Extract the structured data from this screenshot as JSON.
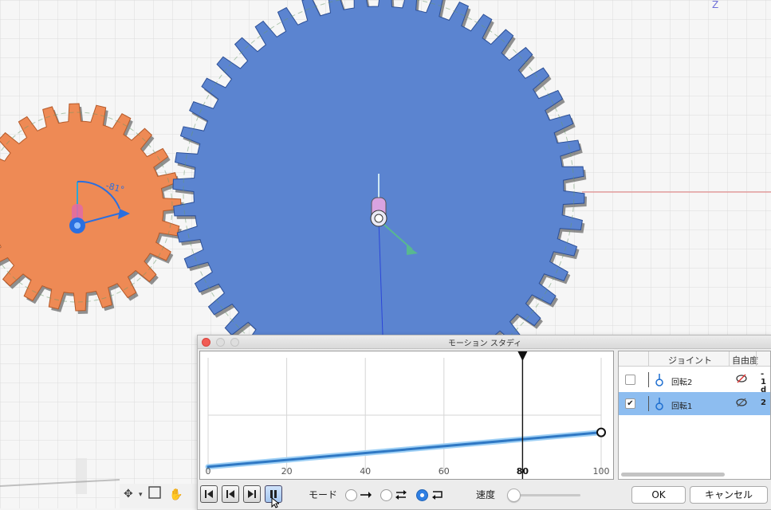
{
  "viewport": {
    "axis_label_z": "Z",
    "angle_label": "-81°"
  },
  "dialog": {
    "title": "モーション スタディ"
  },
  "graph": {
    "x_ticks": [
      "0",
      "20",
      "40",
      "60",
      "80",
      "100"
    ],
    "playhead_value": 80
  },
  "chart_data": {
    "type": "line",
    "x": [
      0,
      100
    ],
    "y": [
      0.05,
      0.35
    ],
    "xticks": [
      "0",
      "20",
      "40",
      "60",
      "80",
      "100"
    ],
    "xlim": [
      0,
      100
    ],
    "ylim": [
      0,
      1
    ],
    "active_tick": "80",
    "series_color": "#2f78c4"
  },
  "joints": {
    "col_joint": "ジョイント",
    "col_dof": "自由度",
    "rows": [
      {
        "checked": false,
        "name": "回転2",
        "value": "-1 d",
        "selected": false
      },
      {
        "checked": true,
        "name": "回転1",
        "value": "2",
        "selected": true
      }
    ]
  },
  "controls": {
    "mode_label": "モード",
    "speed_label": "速度",
    "speed_fraction": 0.05,
    "ok_label": "OK",
    "cancel_label": "キャンセル"
  },
  "colors": {
    "orange_gear": "#ee8a55",
    "blue_gear": "#5b84d0",
    "accent": "#2f7fe3"
  }
}
